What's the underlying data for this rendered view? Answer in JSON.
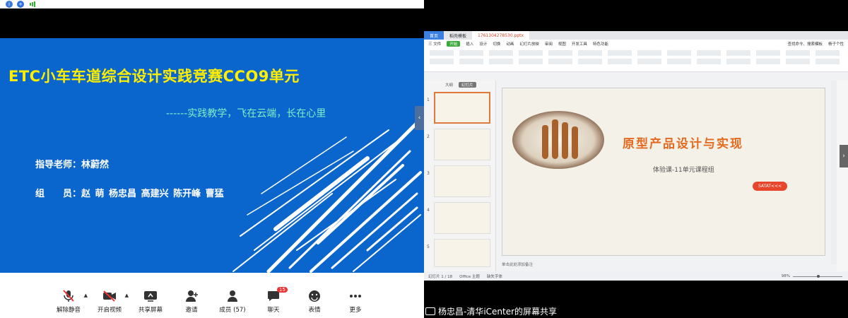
{
  "left": {
    "slide": {
      "title": "ETC小车车道综合设计实践竞赛CCO9单元",
      "subtitle": "------实践教学，飞在云端，长在心里",
      "teacher": "指导老师：林蔚然",
      "members": "组　　员：赵  萌  杨忠昌  高建兴  陈开峰  曹猛"
    },
    "toolbar": {
      "items": [
        {
          "label": "解除静音",
          "icon": "mic-muted-icon"
        },
        {
          "label": "开启视频",
          "icon": "video-off-icon"
        },
        {
          "label": "共享屏幕",
          "icon": "share-screen-icon"
        },
        {
          "label": "邀请",
          "icon": "invite-user-icon"
        },
        {
          "label": "成员 (57)",
          "icon": "members-icon"
        },
        {
          "label": "聊天",
          "icon": "chat-icon",
          "badge": "15"
        },
        {
          "label": "表情",
          "icon": "emoji-icon"
        },
        {
          "label": "更多",
          "icon": "more-icon"
        }
      ]
    }
  },
  "right": {
    "titlebar": {
      "home_tab": "首页",
      "template_tab": "稻壳模板",
      "file_tab": "1761304278530.pptx"
    },
    "menubar": [
      "三 文件",
      "开始",
      "插入",
      "设计",
      "切换",
      "动画",
      "幻灯片放映",
      "审阅",
      "视图",
      "开发工具",
      "特色功能"
    ],
    "menubar_active": "开始",
    "search": "查找命令、搜索模板",
    "user": "杨子个性",
    "thumb_tabs": [
      "大纲",
      "幻灯片"
    ],
    "slide": {
      "title": "原型产品设计与实现",
      "subtitle": "体验课-11单元课程组",
      "button": "SATAT<<<"
    },
    "notes": "单击此处添加备注",
    "status": {
      "slide_info": "幻灯片 1 / 18",
      "theme": "Office 主题",
      "font": "缺失字体",
      "zoom": "98%"
    },
    "caption": "杨忠昌-清华iCenter的屏幕共享"
  }
}
